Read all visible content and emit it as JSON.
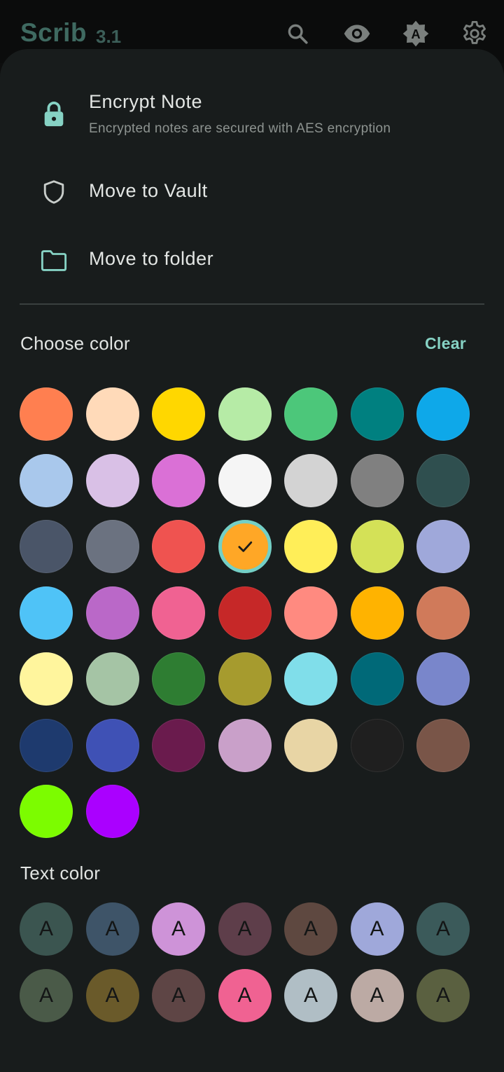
{
  "app": {
    "name": "Scrib",
    "version": "3.1"
  },
  "appbar_icons": [
    "search-icon",
    "eye-icon",
    "auto-brightness-icon",
    "gear-icon"
  ],
  "menu": {
    "encrypt": {
      "label": "Encrypt Note",
      "subtitle": "Encrypted notes are secured with AES encryption"
    },
    "vault": {
      "label": "Move to Vault"
    },
    "folder": {
      "label": "Move to folder"
    }
  },
  "choose_color": {
    "title": "Choose color",
    "clear_label": "Clear",
    "selected_index": 17,
    "colors": [
      "#FF7F50",
      "#FFDAB9",
      "#FFD700",
      "#B6EBA6",
      "#4CC77A",
      "#008080",
      "#0EA8E9",
      "#A9C8EC",
      "#D9C0E6",
      "#DA70D6",
      "#F5F5F5",
      "#D3D3D3",
      "#808080",
      "#2F4F4F",
      "#4A5568",
      "#6B7280",
      "#EF5350",
      "#FFA726",
      "#FFEE58",
      "#D4E157",
      "#9FA8DA",
      "#4FC3F7",
      "#BA68C8",
      "#F06292",
      "#C62828",
      "#FF8A80",
      "#FFB300",
      "#D07A5A",
      "#FFF59D",
      "#A5C4A5",
      "#2E7D32",
      "#A69B2E",
      "#80DEEA",
      "#006978",
      "#7986CB",
      "#1E3A6E",
      "#3F51B5",
      "#6A1B4D",
      "#C9A0C9",
      "#E8D5A5",
      "#1F1F1F",
      "#795548",
      "#7CFC00",
      "#AA00FF"
    ]
  },
  "text_color": {
    "title": "Text color",
    "glyph": "A",
    "colors": [
      "#3B5550",
      "#3E5468",
      "#CE93D8",
      "#5E3E4A",
      "#5E4840",
      "#9FA8DA",
      "#3B5A5A",
      "#4A5A48",
      "#6A5A2A",
      "#5E4545",
      "#F06292",
      "#B0BEC5",
      "#BCAAA4",
      "#5A6040"
    ]
  }
}
